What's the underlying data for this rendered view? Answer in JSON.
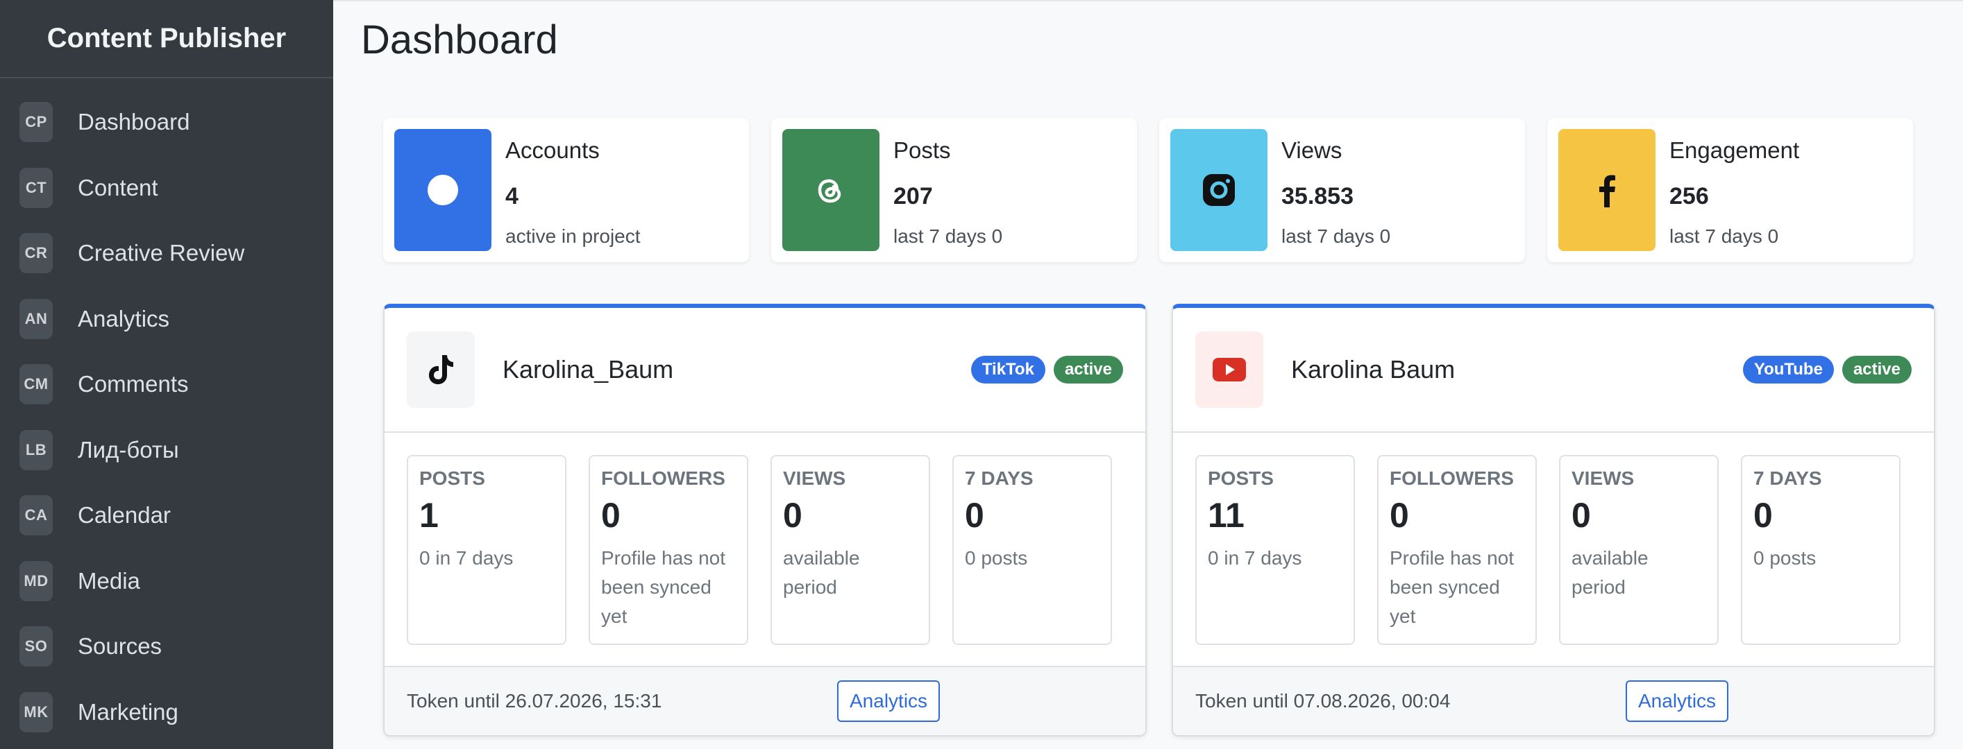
{
  "brand": "Content Publisher",
  "nav": [
    {
      "code": "CP",
      "label": "Dashboard"
    },
    {
      "code": "CT",
      "label": "Content"
    },
    {
      "code": "CR",
      "label": "Creative Review"
    },
    {
      "code": "AN",
      "label": "Analytics"
    },
    {
      "code": "CM",
      "label": "Comments"
    },
    {
      "code": "LB",
      "label": "Лид-боты"
    },
    {
      "code": "CA",
      "label": "Calendar"
    },
    {
      "code": "MD",
      "label": "Media"
    },
    {
      "code": "SO",
      "label": "Sources"
    },
    {
      "code": "MK",
      "label": "Marketing"
    }
  ],
  "page_title": "Dashboard",
  "stats": [
    {
      "title": "Accounts",
      "value": "4",
      "sub": "active in project",
      "icon": "circle-icon",
      "color": "#3270e6"
    },
    {
      "title": "Posts",
      "value": "207",
      "sub": "last 7 days 0",
      "icon": "threads-icon",
      "color": "#3d8a57"
    },
    {
      "title": "Views",
      "value": "35.853",
      "sub": "last 7 days 0",
      "icon": "instagram-icon",
      "color": "#5bc8ec"
    },
    {
      "title": "Engagement",
      "value": "256",
      "sub": "last 7 days 0",
      "icon": "facebook-icon",
      "color": "#f5c442"
    }
  ],
  "accounts": [
    {
      "name": "Karolina_Baum",
      "platform": "TikTok",
      "platform_color": "#3270e6",
      "status": "active",
      "status_color": "#3d8a57",
      "icon": "tiktok-icon",
      "metrics": [
        {
          "label": "POSTS",
          "value": "1",
          "sub": "0 in 7 days"
        },
        {
          "label": "FOLLOWERS",
          "value": "0",
          "sub": "Profile has not been synced yet"
        },
        {
          "label": "VIEWS",
          "value": "0",
          "sub": "available period"
        },
        {
          "label": "7 DAYS",
          "value": "0",
          "sub": "0 posts"
        }
      ],
      "token": "Token until 26.07.2026, 15:31",
      "action": "Analytics"
    },
    {
      "name": "Karolina Baum",
      "platform": "YouTube",
      "platform_color": "#3270e6",
      "status": "active",
      "status_color": "#3d8a57",
      "icon": "youtube-icon",
      "metrics": [
        {
          "label": "POSTS",
          "value": "11",
          "sub": "0 in 7 days"
        },
        {
          "label": "FOLLOWERS",
          "value": "0",
          "sub": "Profile has not been synced yet"
        },
        {
          "label": "VIEWS",
          "value": "0",
          "sub": "available period"
        },
        {
          "label": "7 DAYS",
          "value": "0",
          "sub": "0 posts"
        }
      ],
      "token": "Token until 07.08.2026, 00:04",
      "action": "Analytics"
    }
  ]
}
